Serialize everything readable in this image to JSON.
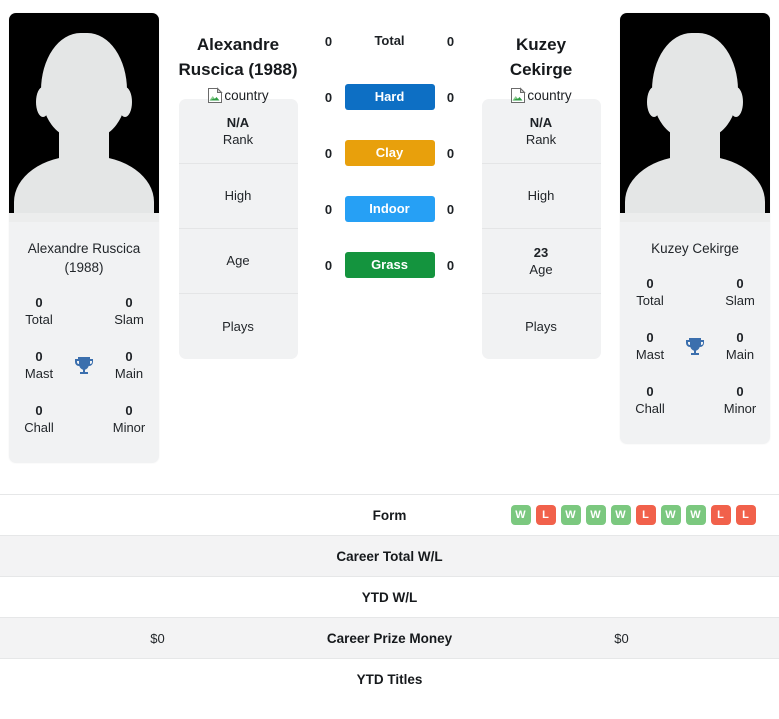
{
  "players": [
    {
      "id": "left",
      "full_name_line1": "Alexandre",
      "full_name_line2": "Ruscica (1988)",
      "country_alt": "country",
      "card_name_line1": "Alexandre Ruscica",
      "card_name_line2": "(1988)",
      "titles": {
        "total_value": "0",
        "total_label": "Total",
        "slam_value": "0",
        "slam_label": "Slam",
        "mast_value": "0",
        "mast_label": "Mast",
        "main_value": "0",
        "main_label": "Main",
        "chall_value": "0",
        "chall_label": "Chall",
        "minor_value": "0",
        "minor_label": "Minor"
      },
      "info": [
        {
          "value": "N/A",
          "label": "Rank"
        },
        {
          "value": "",
          "label": "High"
        },
        {
          "value": "",
          "label": "Age"
        },
        {
          "value": "",
          "label": "Plays"
        }
      ],
      "surface_counts": {
        "total": "0",
        "hard": "0",
        "clay": "0",
        "indoor": "0",
        "grass": "0"
      }
    },
    {
      "id": "right",
      "full_name_line1": "Kuzey",
      "full_name_line2": "Cekirge",
      "country_alt": "country",
      "card_name_line1": "Kuzey Cekirge",
      "card_name_line2": "",
      "titles": {
        "total_value": "0",
        "total_label": "Total",
        "slam_value": "0",
        "slam_label": "Slam",
        "mast_value": "0",
        "mast_label": "Mast",
        "main_value": "0",
        "main_label": "Main",
        "chall_value": "0",
        "chall_label": "Chall",
        "minor_value": "0",
        "minor_label": "Minor"
      },
      "info": [
        {
          "value": "N/A",
          "label": "Rank"
        },
        {
          "value": "",
          "label": "High"
        },
        {
          "value": "23",
          "label": "Age"
        },
        {
          "value": "",
          "label": "Plays"
        }
      ],
      "surface_counts": {
        "total": "0",
        "hard": "0",
        "clay": "0",
        "indoor": "0",
        "grass": "0"
      }
    }
  ],
  "surfaces": [
    {
      "key": "total",
      "label": "Total",
      "color": "",
      "styled": false
    },
    {
      "key": "hard",
      "label": "Hard",
      "color": "#0d6fc4",
      "styled": true
    },
    {
      "key": "clay",
      "label": "Clay",
      "color": "#e8a00c",
      "styled": true
    },
    {
      "key": "indoor",
      "label": "Indoor",
      "color": "#26a0f5",
      "styled": true
    },
    {
      "key": "grass",
      "label": "Grass",
      "color": "#14943e",
      "styled": true
    }
  ],
  "table_rows": [
    {
      "label": "Form",
      "left_value": "",
      "right_value": "",
      "type": "form",
      "shaded": false
    },
    {
      "label": "Career Total W/L",
      "left_value": "",
      "right_value": "",
      "type": "text",
      "shaded": true
    },
    {
      "label": "YTD W/L",
      "left_value": "",
      "right_value": "",
      "type": "text",
      "shaded": false
    },
    {
      "label": "Career Prize Money",
      "left_value": "$0",
      "right_value": "$0",
      "type": "text",
      "shaded": true
    },
    {
      "label": "YTD Titles",
      "left_value": "",
      "right_value": "",
      "type": "text",
      "shaded": false
    }
  ],
  "form": {
    "results": [
      "W",
      "L",
      "W",
      "W",
      "W",
      "L",
      "W",
      "W",
      "L",
      "L"
    ],
    "win_color": "#7bc87f",
    "loss_color": "#f1614b"
  },
  "icons": {
    "trophy": "trophy-icon",
    "broken_image": "broken-image-icon"
  },
  "colors": {
    "card_bg": "#f1f2f3",
    "photo_bg": "#000000",
    "row_shaded": "#f3f3f4"
  }
}
